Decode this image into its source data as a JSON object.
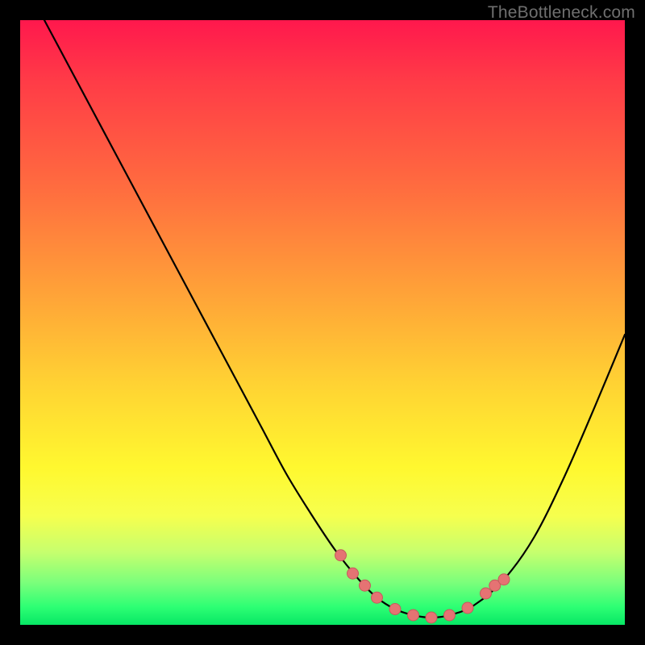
{
  "watermark": "TheBottleneck.com",
  "colors": {
    "frame": "#000000",
    "gradient_top": "#ff184d",
    "gradient_bottom": "#07e765",
    "curve": "#000000",
    "marker_fill": "#e57373",
    "marker_stroke": "#c45b5b"
  },
  "chart_data": {
    "type": "line",
    "title": "",
    "xlabel": "",
    "ylabel": "",
    "xlim": [
      0,
      100
    ],
    "ylim": [
      0,
      100
    ],
    "series": [
      {
        "name": "bottleneck-curve",
        "x": [
          4,
          8,
          12,
          16,
          20,
          24,
          28,
          32,
          36,
          40,
          44,
          48,
          52,
          56,
          59,
          62,
          65,
          68,
          71,
          75,
          80,
          85,
          90,
          95,
          100
        ],
        "y": [
          100,
          92.5,
          85,
          77.5,
          70,
          62.5,
          55,
          47.5,
          40,
          32.5,
          25,
          18.5,
          12.5,
          7.5,
          4.5,
          2.6,
          1.6,
          1.2,
          1.6,
          3.2,
          7.5,
          14.5,
          24.5,
          36,
          48
        ],
        "smooth": true
      }
    ],
    "markers": {
      "name": "highlight-points",
      "x": [
        53,
        55,
        57,
        59,
        62,
        65,
        68,
        71,
        74,
        77,
        78.5,
        80
      ],
      "y": [
        11.5,
        8.5,
        6.5,
        4.5,
        2.6,
        1.6,
        1.2,
        1.6,
        2.8,
        5.2,
        6.5,
        7.5
      ]
    }
  }
}
